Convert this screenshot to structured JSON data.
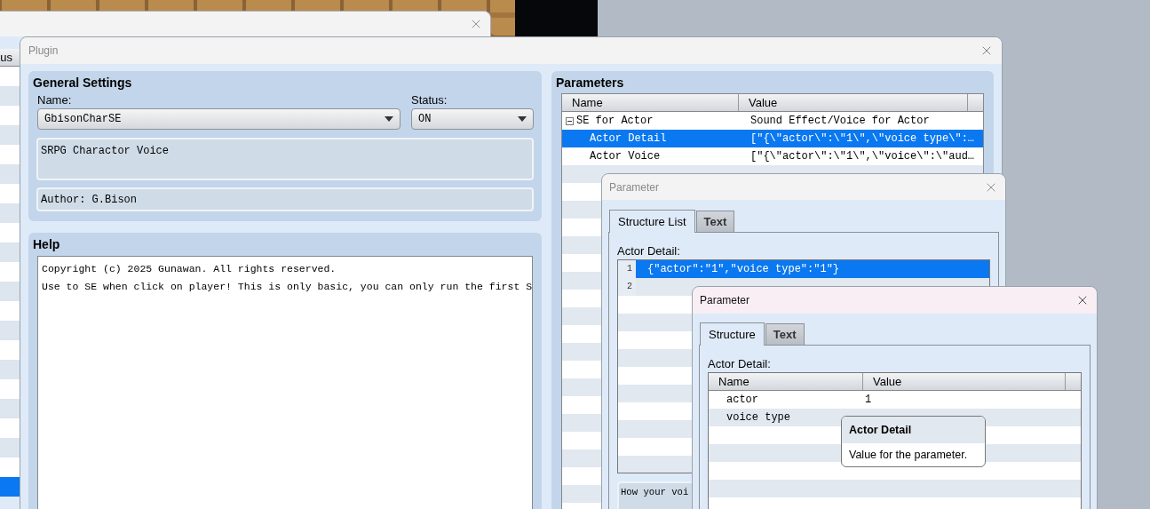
{
  "back_window": {
    "list": {
      "header": "us",
      "rows": [
        {
          "selected": false
        },
        {
          "selected": false
        },
        {
          "selected": false
        },
        {
          "selected": false
        },
        {
          "selected": false
        },
        {
          "selected": false
        },
        {
          "selected": false
        },
        {
          "selected": false
        },
        {
          "selected": false
        },
        {
          "selected": false
        },
        {
          "selected": false
        },
        {
          "selected": false
        },
        {
          "selected": false
        },
        {
          "selected": false
        },
        {
          "selected": false
        },
        {
          "selected": false
        },
        {
          "selected": false
        },
        {
          "selected": false
        },
        {
          "selected": false
        },
        {
          "selected": false
        },
        {
          "selected": false
        },
        {
          "selected": true
        }
      ]
    }
  },
  "plugin_window": {
    "title": "Plugin",
    "general_settings": {
      "title": "General Settings",
      "name_label": "Name:",
      "name_value": "GbisonCharSE",
      "status_label": "Status:",
      "status_value": "ON",
      "description": "SRPG Charactor Voice",
      "author": "Author: G.Bison"
    },
    "help": {
      "title": "Help",
      "lines": [
        "Copyright (c) 2025 Gunawan. All rights reserved.",
        "Use to SE when click on player! This is only basic, you can only run the first S"
      ]
    },
    "parameters": {
      "title": "Parameters",
      "columns": [
        "Name",
        "Value"
      ],
      "rows": [
        {
          "name": "SE for Actor",
          "value": "Sound Effect/Voice for Actor",
          "expanded": true,
          "selected": false,
          "children": [
            {
              "name": "Actor Detail",
              "value": "[\"{\\\"actor\\\":\\\"1\\\",\\\"voice type\\\":…",
              "selected": true
            },
            {
              "name": "Actor Voice",
              "value": "[\"{\\\"actor\\\":\\\"1\\\",\\\"voice\\\":\\\"aud…",
              "selected": false
            }
          ]
        }
      ]
    }
  },
  "parameter_window": {
    "title": "Parameter",
    "tabs": [
      {
        "label": "Structure List",
        "selected": true
      },
      {
        "label": "Text",
        "selected": false
      }
    ],
    "field_label": "Actor Detail:",
    "lines": [
      {
        "number": "1",
        "text": "{\"actor\":\"1\",\"voice type\":\"1\"}",
        "selected": true
      },
      {
        "number": "2",
        "selected": false
      }
    ],
    "note": "How your voi"
  },
  "parameter_window_2": {
    "title": "Parameter",
    "tabs": [
      {
        "label": "Structure",
        "selected": true
      },
      {
        "label": "Text",
        "selected": false
      }
    ],
    "field_label": "Actor Detail:",
    "columns": [
      "Name",
      "Value"
    ],
    "rows": [
      {
        "name": "actor",
        "value": "1"
      },
      {
        "name": "voice type"
      }
    ]
  },
  "tooltip": {
    "title": "Actor Detail",
    "text": "Value for the parameter."
  }
}
